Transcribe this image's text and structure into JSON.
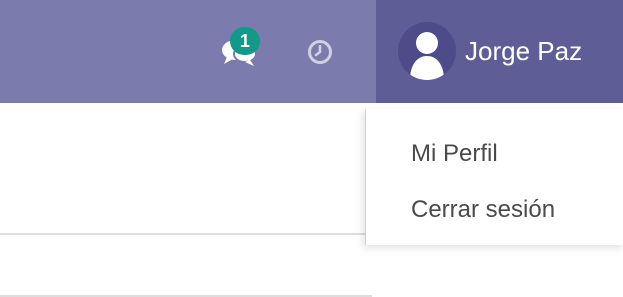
{
  "navbar": {
    "background_color": "#7c7bad",
    "messages": {
      "icon": "chat-bubbles-icon",
      "unread_count": "1",
      "badge_color": "#119a8a"
    },
    "activity": {
      "icon": "clock-icon"
    },
    "user_menu": {
      "name": "Jorge Paz",
      "avatar_icon": "user-silhouette-icon",
      "background_color": "#5f5d95"
    }
  },
  "dropdown": {
    "items": [
      {
        "label": "Mi Perfil"
      },
      {
        "label": "Cerrar sesión"
      }
    ]
  }
}
